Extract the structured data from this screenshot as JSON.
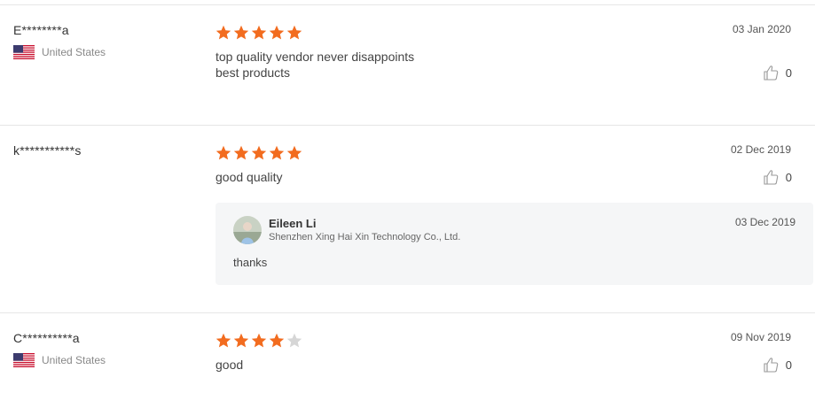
{
  "colors": {
    "star_filled": "#f26c1f",
    "star_empty": "#d6d6d6",
    "reply_bg": "#f5f6f7"
  },
  "reviews": [
    {
      "reviewer": "E********a",
      "country": "United States",
      "country_flag_icon": "us-flag-icon",
      "rating": 5,
      "lines": [
        "top quality vendor never disappoints",
        "best products"
      ],
      "date": "03 Jan 2020",
      "likes": "0"
    },
    {
      "reviewer": "k***********s",
      "rating": 5,
      "lines": [
        "good quality"
      ],
      "date": "02 Dec 2019",
      "likes": "0",
      "reply": {
        "name": "Eileen Li",
        "company": "Shenzhen Xing Hai Xin Technology Co., Ltd.",
        "date": "03 Dec 2019",
        "text": "thanks"
      }
    },
    {
      "reviewer": "C**********a",
      "country": "United States",
      "country_flag_icon": "us-flag-icon",
      "rating": 4,
      "lines": [
        "good"
      ],
      "date": "09 Nov 2019",
      "likes": "0"
    }
  ]
}
